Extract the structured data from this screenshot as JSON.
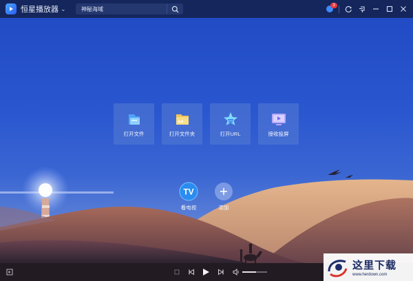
{
  "app": {
    "title": "恒星播放器"
  },
  "search": {
    "value": "神秘海域"
  },
  "notifications": {
    "count": "3"
  },
  "tiles": [
    {
      "label": "打开文件",
      "icon": "file-icon"
    },
    {
      "label": "打开文件夹",
      "icon": "folder-icon"
    },
    {
      "label": "打开URL",
      "icon": "star-url-icon"
    },
    {
      "label": "接收投屏",
      "icon": "screen-cast-icon"
    }
  ],
  "tv": {
    "label": "看电视",
    "badge_text": "TV"
  },
  "add": {
    "label": "添加"
  },
  "player": {
    "volume": 0.55
  },
  "watermark": {
    "cn": "这里下载",
    "url": "www.herdown.com"
  },
  "colors": {
    "accent": "#2b5fd9",
    "titlebar": "#14265c",
    "badge": "#e8383d"
  }
}
